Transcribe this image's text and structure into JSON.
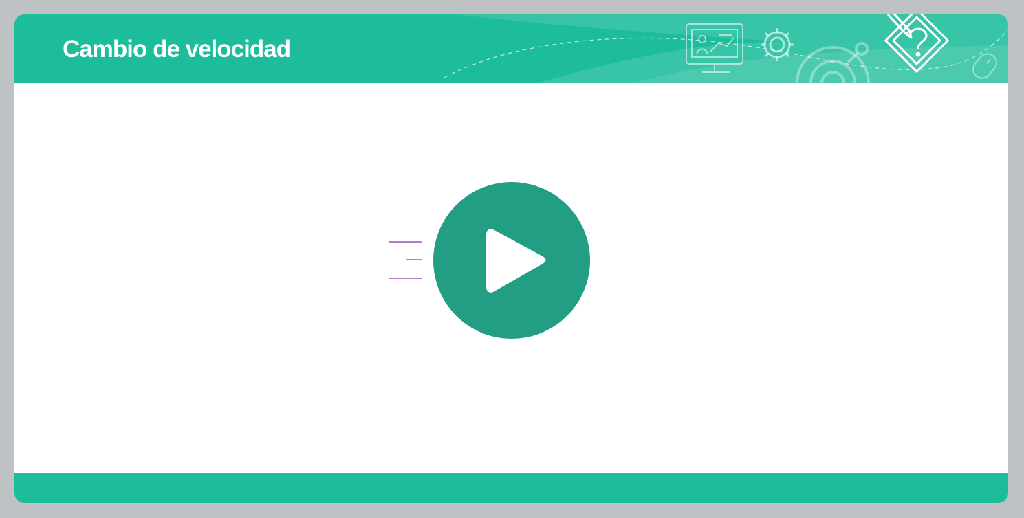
{
  "header": {
    "title": "Cambio de velocidad",
    "background_color": "#1dbc9b",
    "decor_icons": [
      "presentation-board-icon",
      "gear-icon",
      "large-gear-icon",
      "pencil-question-icon",
      "mouse-icon"
    ]
  },
  "player": {
    "button_icon": "play-icon",
    "button_color": "#229e84",
    "speed_lines_color": "#8e2ca8"
  },
  "footer": {
    "background_color": "#1dbc9b"
  },
  "page": {
    "background_color": "#bfc2c5"
  }
}
